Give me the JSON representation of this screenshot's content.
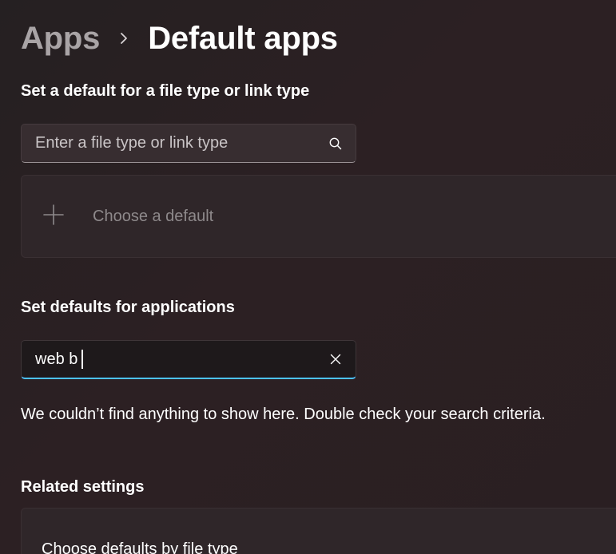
{
  "breadcrumb": {
    "parent": "Apps",
    "separator_icon": "chevron-right-icon",
    "current": "Default apps"
  },
  "file_type_section": {
    "heading": "Set a default for a file type or link type",
    "search": {
      "placeholder": "Enter a file type or link type",
      "value": "",
      "icon": "search-icon"
    },
    "choose_default": {
      "icon": "plus-icon",
      "label": "Choose a default"
    }
  },
  "applications_section": {
    "heading": "Set defaults for applications",
    "search": {
      "value": "web b",
      "clear_icon": "close-icon"
    },
    "empty_message": "We couldn’t find anything to show here. Double check your search criteria."
  },
  "related_settings": {
    "heading": "Related settings",
    "items": [
      {
        "label": "Choose defaults by file type"
      }
    ]
  },
  "colors": {
    "accent": "#4cc2ff",
    "background": "#2a2024",
    "card": "#2f2629",
    "secondary_text": "#a9a4a6"
  }
}
